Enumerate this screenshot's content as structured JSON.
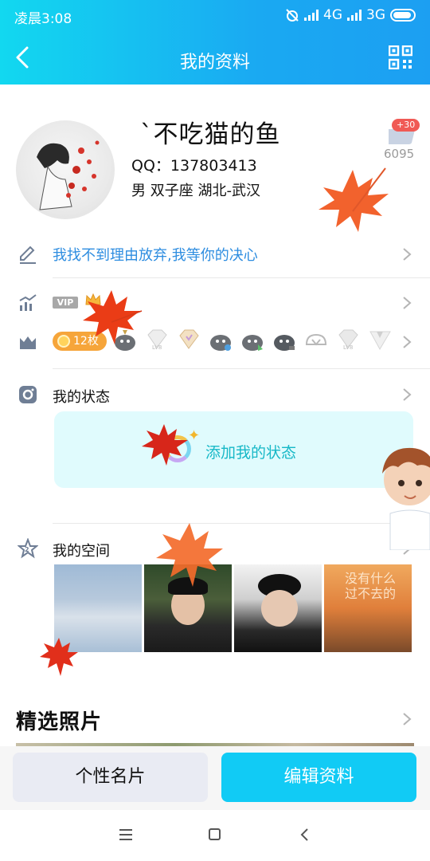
{
  "status_bar": {
    "time": "凌晨3:08",
    "network1": "4G",
    "network2": "3G"
  },
  "nav": {
    "title": "我的资料"
  },
  "profile": {
    "nickname": "`不吃猫的鱼",
    "qq": "QQ：137803413",
    "info": "男  双子座  湖北-武汉",
    "likes_badge": "+30",
    "likes_count": "6095"
  },
  "signature": "我找不到理由放弃,我等你的决心",
  "vip": {
    "label": "VIP"
  },
  "coins": {
    "label": "12枚"
  },
  "medals": [
    "medal-1",
    "medal-2",
    "medal-3",
    "medal-4",
    "medal-5",
    "medal-6",
    "medal-7",
    "medal-8",
    "medal-9"
  ],
  "my_status": {
    "label": "我的状态",
    "add_label": "添加我的状态"
  },
  "my_space": {
    "label": "我的空间"
  },
  "photos_overlay": "没有什么过不去的",
  "featured": {
    "label": "精选照片"
  },
  "actions": {
    "card_label": "个性名片",
    "edit_label": "编辑资料"
  },
  "colors": {
    "accent": "#11cbf5",
    "link": "#2e8de0",
    "status_text": "#17b8c7",
    "badge": "#f05a55"
  }
}
